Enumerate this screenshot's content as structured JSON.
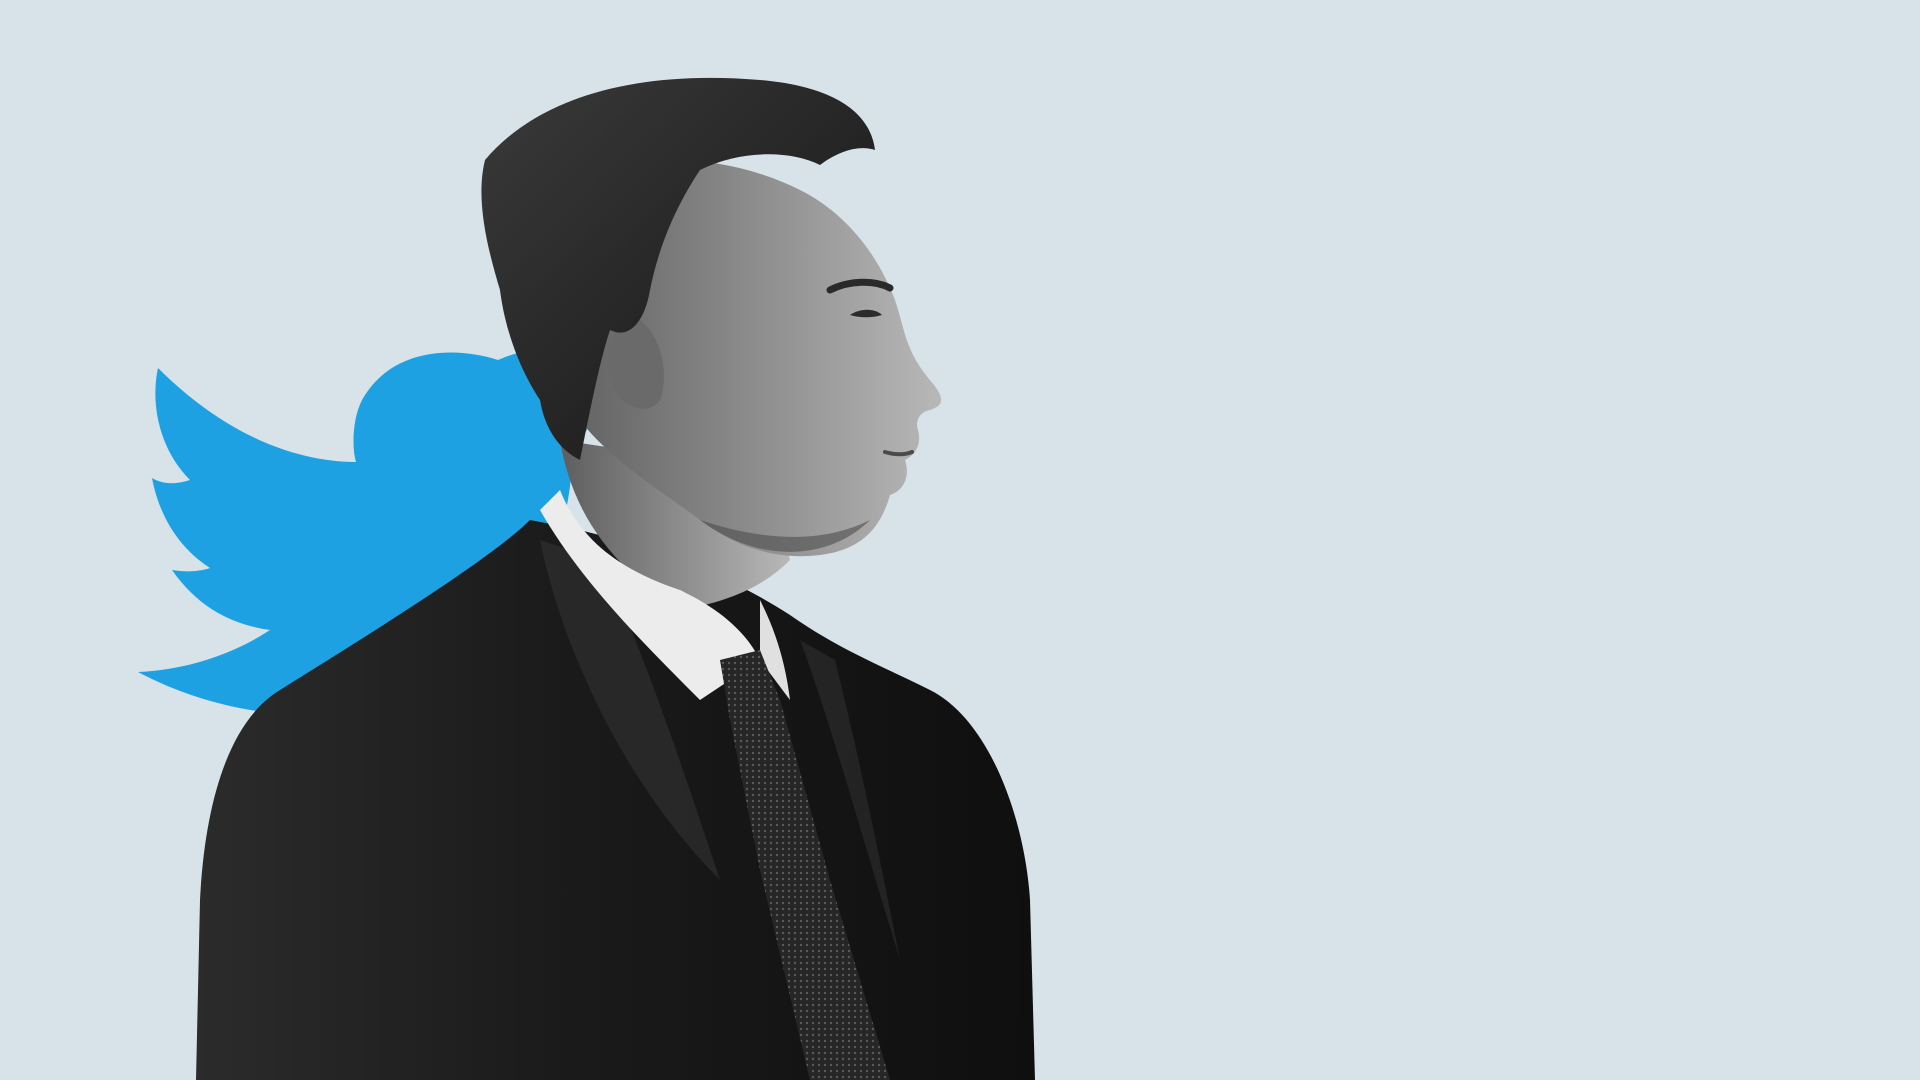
{
  "scene": {
    "background_color": "#d7e3e9",
    "logo": {
      "icon": "twitter-bird-icon",
      "color": "#1da1e2"
    },
    "portrait": {
      "style": "black-and-white photographic cutout, right-facing profile",
      "suit_color": "#1a1a1a",
      "shirt_color": "#eaeaea",
      "hair_color": "#232323",
      "skin_tone": "#8a8a8a"
    }
  }
}
